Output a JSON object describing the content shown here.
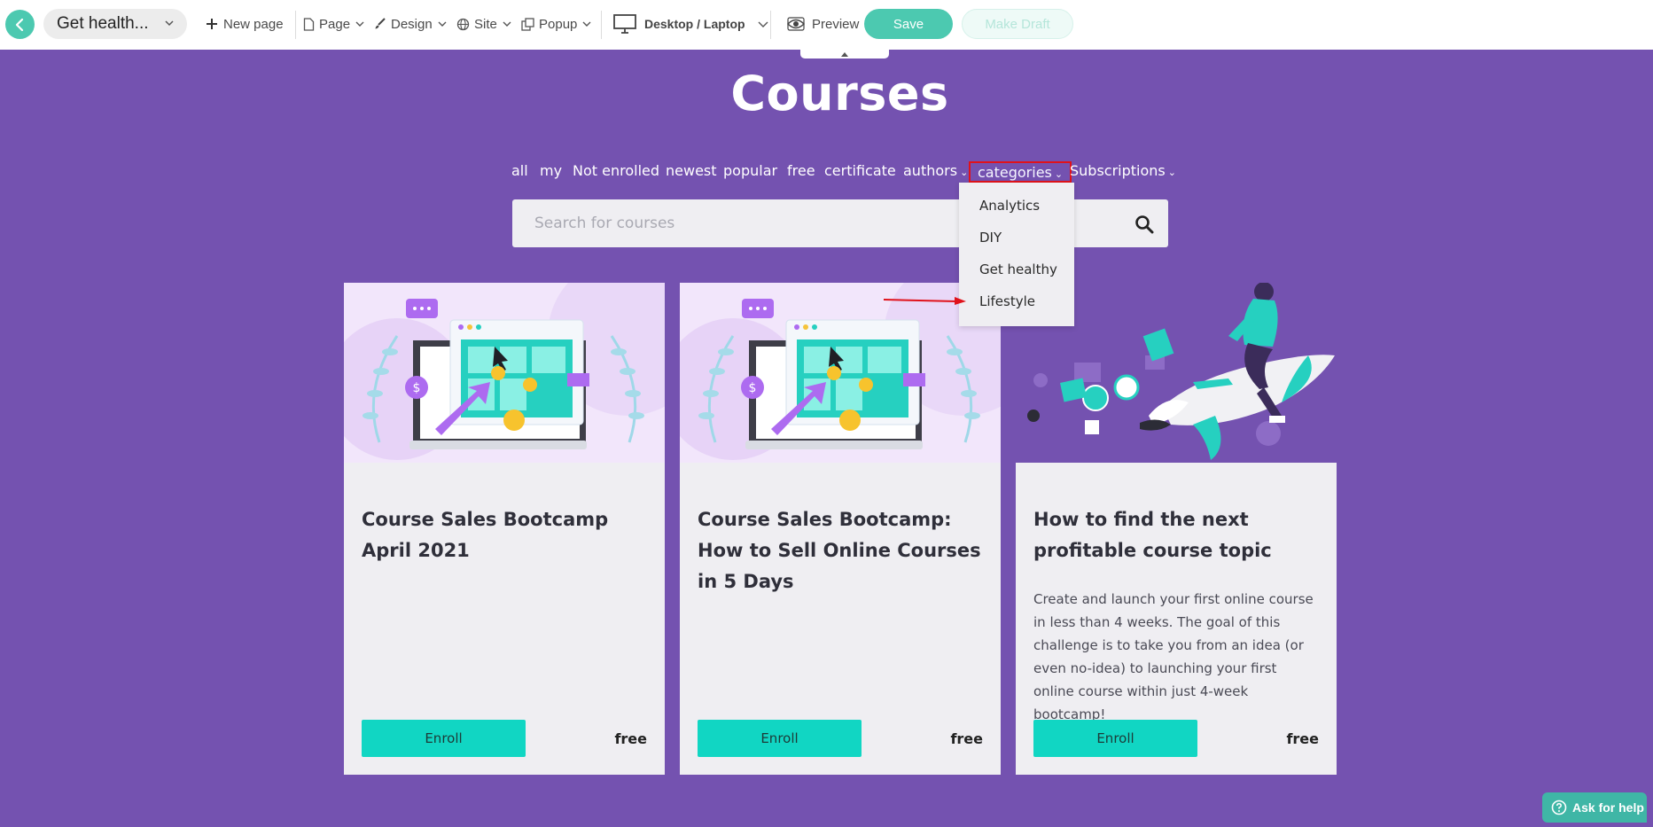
{
  "toolbar": {
    "page_name": "Get health...",
    "new_page_label": "New page",
    "page_menu_label": "Page",
    "design_menu_label": "Design",
    "site_menu_label": "Site",
    "popup_menu_label": "Popup",
    "device_label": "Desktop / Laptop",
    "preview_label": "Preview",
    "save_label": "Save",
    "draft_label": "Make Draft"
  },
  "main": {
    "title": "Courses",
    "filters": [
      "all",
      "my",
      "Not enrolled",
      "newest",
      "popular",
      "free",
      "certificate",
      "authors",
      "categories",
      "Subscriptions"
    ],
    "active_filter": "categories",
    "categories_dropdown": [
      "Analytics",
      "DIY",
      "Get healthy",
      "Lifestyle"
    ],
    "search_placeholder": "Search for courses"
  },
  "courses": [
    {
      "title": "Course Sales Bootcamp April 2021",
      "description": "",
      "enroll_label": "Enroll",
      "price": "free"
    },
    {
      "title": "Course Sales Bootcamp: How to Sell Online Courses in 5 Days",
      "description": "",
      "enroll_label": "Enroll",
      "price": "free"
    },
    {
      "title": "How to find the next profitable course topic",
      "description": "Create and launch your first online course in less than 4 weeks. The goal of this challenge is to take you from an idea (or even no-idea) to launching your first online course within just 4-week bootcamp!",
      "enroll_label": "Enroll",
      "price": "free"
    }
  ],
  "help": {
    "label": "Ask for help"
  },
  "colors": {
    "page_bg": "#7452b0",
    "accent": "#4cc9b0",
    "enroll": "#11d6c3",
    "card_bg": "#efeef2",
    "highlight": "#e0121b"
  },
  "icons": [
    "back-arrow-icon",
    "chevron-down-icon",
    "plus-icon",
    "page-icon",
    "brush-icon",
    "globe-icon",
    "popup-icon",
    "monitor-icon",
    "eye-icon",
    "search-icon",
    "question-icon",
    "caret-up-icon"
  ]
}
